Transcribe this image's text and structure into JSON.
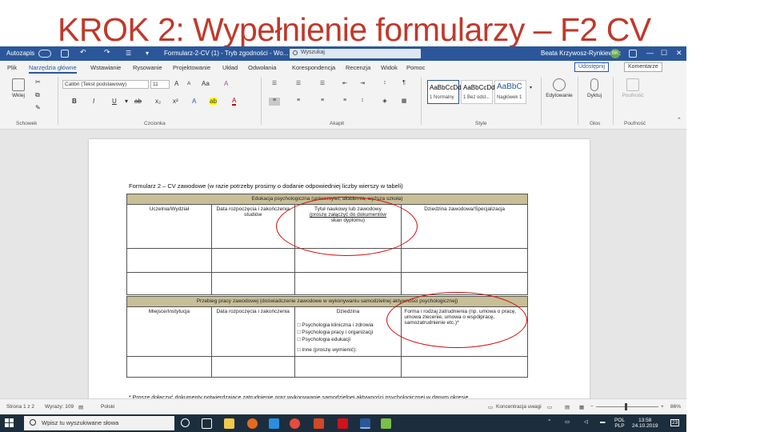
{
  "slide": {
    "title": "KROK 2: Wypełnienie formularzy – F2 CV"
  },
  "titlebar": {
    "autosave": "Autozapis",
    "document_name": "Formularz-2-CV (1) - Tryb zgodności - Wo...",
    "search_placeholder": "Wyszukaj",
    "user_name": "Beata Krzywosz-Rynkiewicz",
    "user_initials": "BK"
  },
  "tabs": [
    "Plik",
    "Narzędzia główne",
    "Wstawianie",
    "Rysowanie",
    "Projektowanie",
    "Układ",
    "Odwołania",
    "Korespondencja",
    "Recenzja",
    "Widok",
    "Pomoc"
  ],
  "active_tab_index": 1,
  "share_label": "Udostępnij",
  "comments_label": "Komentarze",
  "ribbon": {
    "clipboard": {
      "paste_label": "Wklej",
      "group_label": "Schowek"
    },
    "font": {
      "name": "Calibri (Tekst podstawowy)",
      "size": "11",
      "bold": "B",
      "italic": "I",
      "underline": "U",
      "group_label": "Czcionka"
    },
    "paragraph": {
      "group_label": "Akapit"
    },
    "styles": {
      "items": [
        {
          "sample": "AaBbCcDd",
          "name": "1 Normalny"
        },
        {
          "sample": "AaBbCcDd",
          "name": "1 Bez odst..."
        },
        {
          "sample": "AaBbC",
          "name": "Nagłówek 1"
        }
      ],
      "group_label": "Style"
    },
    "editing": {
      "label": "Edytowanie"
    },
    "voice": {
      "label": "Dyktuj",
      "group_label": "Głos"
    },
    "sensitivity": {
      "label": "Poufność",
      "group_label": "Poufność"
    }
  },
  "document": {
    "form_title": "Formularz 2 – CV zawodowe (w razie potrzeby prosimy o dodanie odpowiedniej liczby wierszy w tabeli)",
    "education": {
      "header": "Edukacja psychologiczna (uniwersytet, akademia, wyższa szkoła)",
      "col1": "Uczelnia/Wydział",
      "col2": "Data rozpoczęcia i zakończenia studiów",
      "col3_line1": "Tytuł naukowy lub zawodowy",
      "col3_line2": "(proszę załączyć do dokumentów",
      "col3_line3": "skan dyplomu)",
      "col4": "Dziedzina zawodowa/Specjalizacja"
    },
    "career": {
      "header": "Przebieg pracy zawodowej (doświadczenie zawodowe w wykonywaniu samodzielnej aktywności psychologicznej)",
      "col1": "Miejsce/Instytucja",
      "col2": "Data rozpoczęcia i zakończenia",
      "col3": "Dziedzina",
      "col3_options": [
        "Psychologia kliniczna i zdrowia",
        "Psychologia pracy i organizacji",
        "Psychologia edukacji",
        "Inne (proszę wymienić):"
      ],
      "col4": "Forma i rodzaj zatrudnienia (np. umowa o pracę, umowa zlecenie, umowa o współpracę, samozatrudnienie etc.)*"
    },
    "cutoff_text": "* Proszę dołączyć dokumenty potwierdzające zatrudnienie oraz wykonywanie samodzielnej aktywności psychologicznej w danym okresie"
  },
  "statusbar": {
    "page": "Strona 1 z 2",
    "words": "Wyrazy: 109",
    "language": "Polski",
    "focus": "Koncentracja uwagi",
    "zoom": "86%"
  },
  "taskbar": {
    "search_placeholder": "Wpisz tu wyszukiwane słowa",
    "lang_top": "POL",
    "lang_bottom": "PLP",
    "time": "13:58",
    "date": "24.10.2019",
    "notifications": "23"
  },
  "colors": {
    "title_red": "#c0392b",
    "word_blue": "#2b579a",
    "section_header": "#c8bf97",
    "annotation_red": "#d10b0b",
    "taskbar": "#1c2e3d"
  }
}
